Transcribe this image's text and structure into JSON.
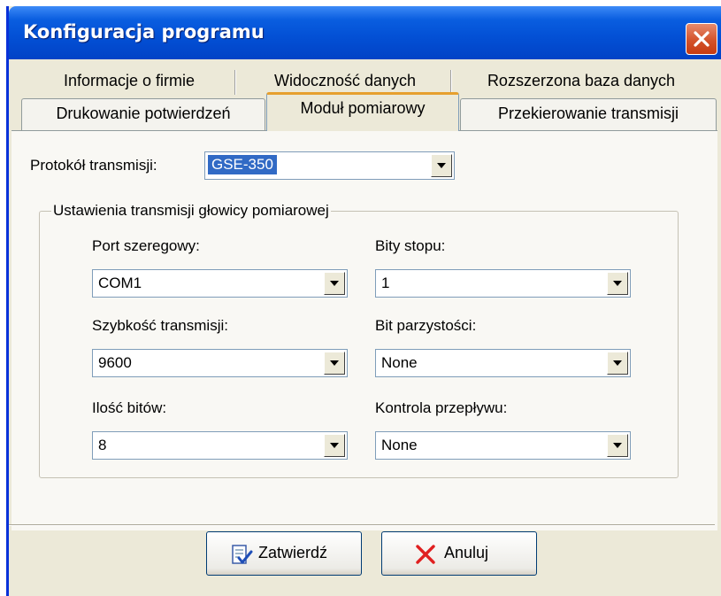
{
  "window": {
    "title": "Konfiguracja programu"
  },
  "tabs": {
    "row_back": [
      "Informacje o firmie",
      "Widoczność danych",
      "Rozszerzona baza danych"
    ],
    "row_front": [
      "Drukowanie potwierdzeń",
      "Moduł pomiarowy",
      "Przekierowanie transmisji"
    ],
    "active": "Moduł pomiarowy"
  },
  "protocol": {
    "label": "Protokół transmisji:",
    "value": "GSE-350"
  },
  "group": {
    "title": "Ustawienia transmisji głowicy pomiarowej",
    "port": {
      "label": "Port szeregowy:",
      "value": "COM1"
    },
    "stop_bits": {
      "label": "Bity stopu:",
      "value": "1"
    },
    "speed": {
      "label": "Szybkość transmisji:",
      "value": "9600"
    },
    "parity": {
      "label": "Bit parzystości:",
      "value": "None"
    },
    "data_bits": {
      "label": "Ilość bitów:",
      "value": "8"
    },
    "flow": {
      "label": "Kontrola przepływu:",
      "value": "None"
    }
  },
  "buttons": {
    "confirm": "Zatwierdź",
    "cancel": "Anuluj"
  },
  "icons": {
    "close": "close-icon",
    "confirm": "document-check-icon",
    "cancel": "red-x-icon",
    "dropdown": "chevron-down-icon"
  },
  "colors": {
    "titlebar": "#0351d6",
    "selection": "#316ac5",
    "active_tab_accent": "#e6a02e",
    "cancel_x": "#e02020"
  }
}
